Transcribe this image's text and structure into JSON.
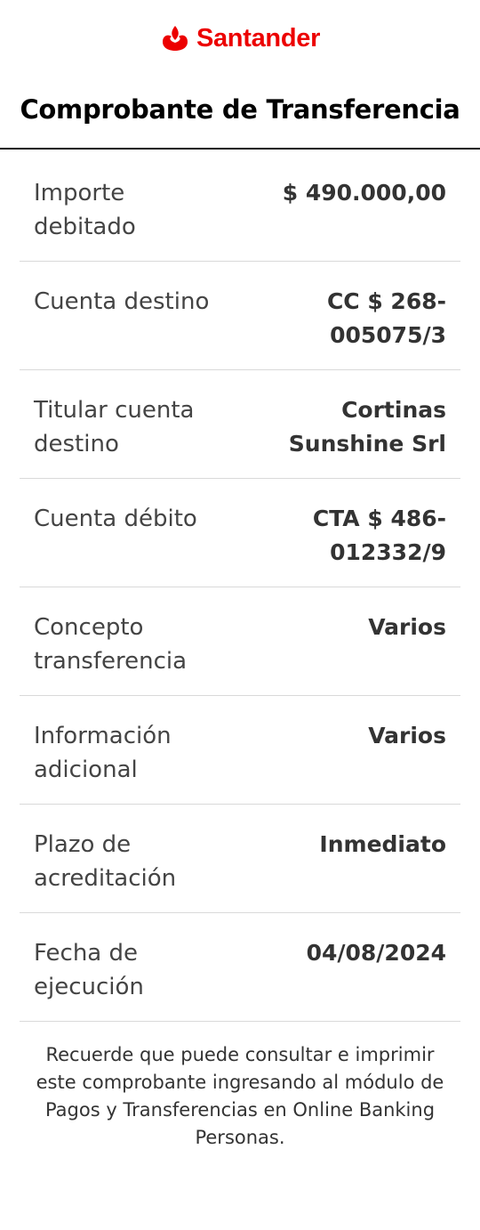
{
  "brand": {
    "name": "Santander",
    "logo_icon": "santander-flame-icon",
    "color": "#ec0000"
  },
  "title": "Comprobante de Transferencia",
  "rows": [
    {
      "label": "Importe debitado",
      "value": "$ 490.000,00"
    },
    {
      "label": "Cuenta destino",
      "value": "CC $ 268-005075/3"
    },
    {
      "label": "Titular cuenta destino",
      "value": "Cortinas Sunshine Srl"
    },
    {
      "label": "Cuenta débito",
      "value": "CTA $ 486-012332/9"
    },
    {
      "label": "Concepto transferencia",
      "value": "Varios"
    },
    {
      "label": "Información adicional",
      "value": "Varios"
    },
    {
      "label": "Plazo de acreditación",
      "value": "Inmediato"
    },
    {
      "label": "Fecha de ejecución",
      "value": "04/08/2024"
    }
  ],
  "footer_note": "Recuerde que puede consultar e imprimir este comprobante ingresando al módulo de Pagos y Transferencias en Online Banking Personas."
}
